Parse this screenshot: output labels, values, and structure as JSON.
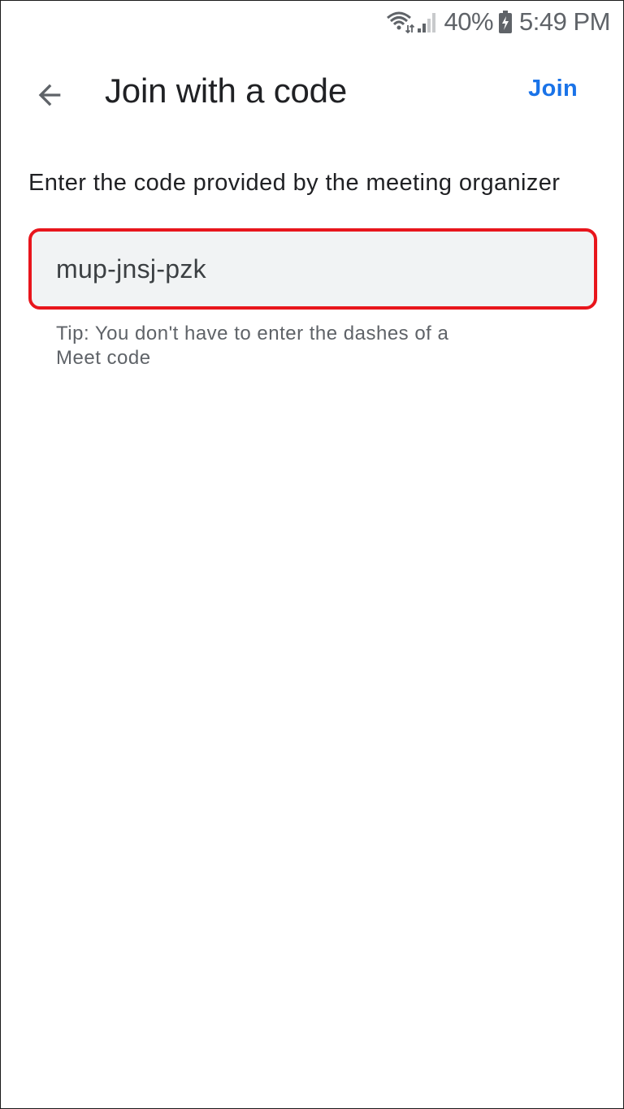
{
  "status_bar": {
    "battery_percent": "40%",
    "time": "5:49 PM",
    "icons": [
      "wifi-icon",
      "signal-icon",
      "battery-charging-icon"
    ]
  },
  "app_bar": {
    "title": "Join with a code",
    "action_label": "Join",
    "back_icon": "arrow-back-icon"
  },
  "content": {
    "instruction": "Enter the code provided by the meeting organizer",
    "code_value": "mup-jnsj-pzk",
    "tip": "Tip: You don't have to enter the dashes of a Meet code"
  },
  "colors": {
    "accent": "#1a73e8",
    "field_background": "#f1f3f4",
    "highlight_border": "#e8151c",
    "secondary_text": "#5f6368"
  }
}
